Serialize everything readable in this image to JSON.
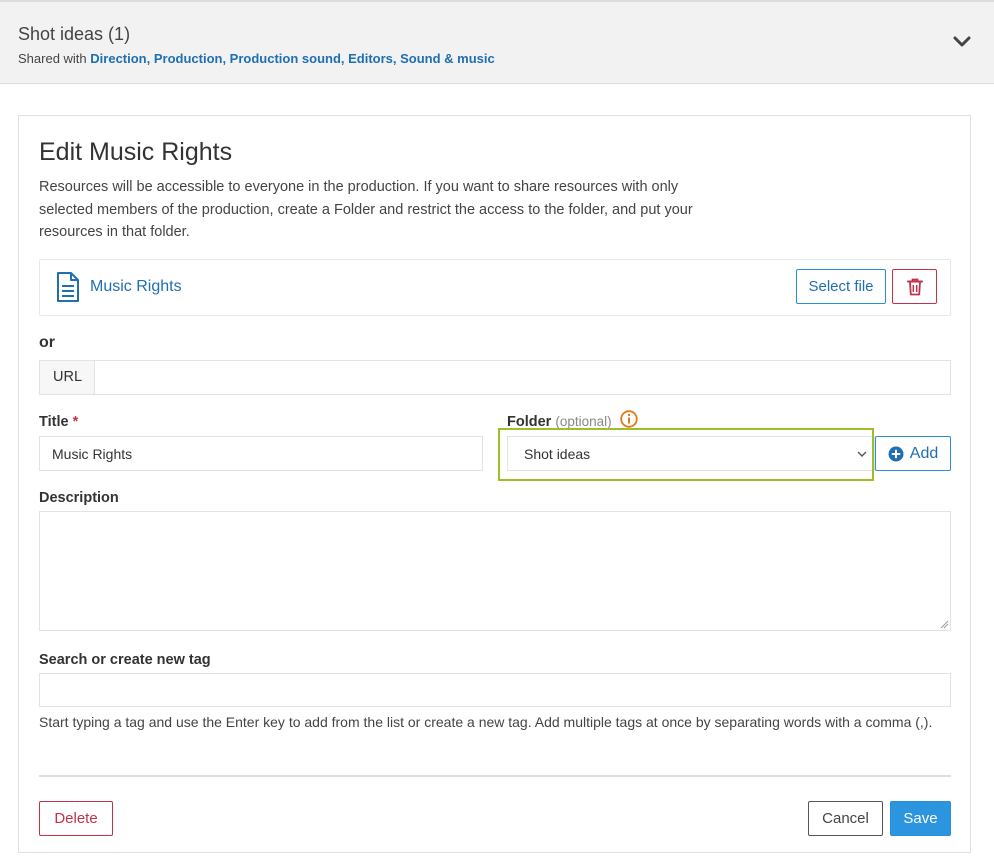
{
  "panel": {
    "title": "Shot ideas (1)",
    "shared_prefix": "Shared with",
    "shared_groups": "Direction, Production, Production sound, Editors, Sound & music"
  },
  "form": {
    "heading": "Edit Music Rights",
    "intro": "Resources will be accessible to everyone in the production. If you want to share resources with only selected members of the production, create a Folder and restrict the access to the folder, and put your resources in that folder.",
    "file": {
      "name": "Music Rights",
      "select_label": "Select file"
    },
    "or_label": "or",
    "url": {
      "addon": "URL",
      "value": ""
    },
    "title": {
      "label": "Title",
      "required_mark": "*",
      "value": "Music Rights"
    },
    "folder": {
      "label": "Folder",
      "optional": "(optional)",
      "selected": "Shot ideas",
      "add_label": "Add"
    },
    "description": {
      "label": "Description",
      "value": ""
    },
    "tags": {
      "label": "Search or create new tag",
      "value": "",
      "help": "Start typing a tag and use the Enter key to add from the list or create a new tag. Add multiple tags at once by separating words with a comma (,)."
    },
    "actions": {
      "delete_label": "Delete",
      "cancel_label": "Cancel",
      "save_label": "Save"
    }
  },
  "colors": {
    "link": "#1f6fb2",
    "primary": "#2b95e0",
    "danger": "#c4314b",
    "focus_ring": "#9fbf2a",
    "info": "#e07a16"
  },
  "icons": [
    "chevron-down-icon",
    "document-icon",
    "trash-icon",
    "info-icon",
    "plus-circle-icon",
    "select-chevron-icon"
  ]
}
